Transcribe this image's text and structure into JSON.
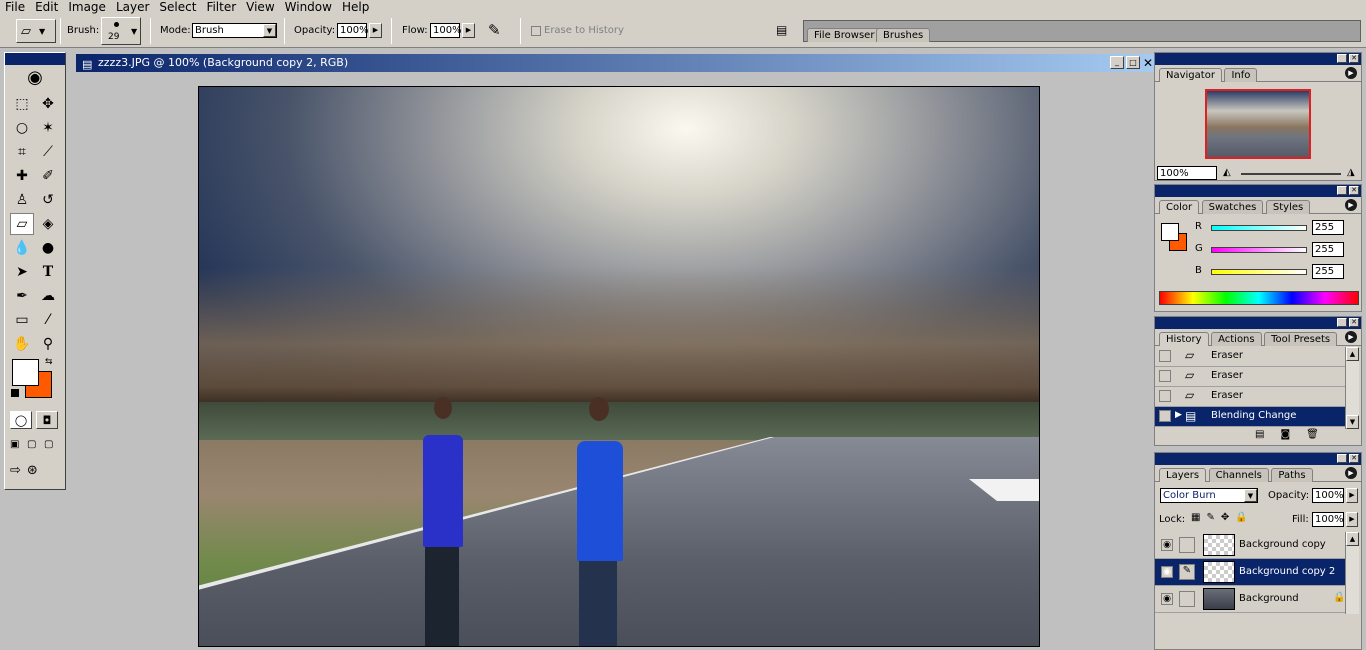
{
  "menu": [
    "File",
    "Edit",
    "Image",
    "Layer",
    "Select",
    "Filter",
    "View",
    "Window",
    "Help"
  ],
  "options": {
    "brush_label": "Brush:",
    "brush_size": "29",
    "mode_label": "Mode:",
    "mode_value": "Brush",
    "opacity_label": "Opacity:",
    "opacity_value": "100%",
    "flow_label": "Flow:",
    "flow_value": "100%",
    "erase_history": "Erase to History",
    "tab_file_browser": "File Browser",
    "tab_brushes": "Brushes"
  },
  "document": {
    "title": "zzzz3.JPG @ 100% (Background copy 2, RGB)"
  },
  "navigator": {
    "tabs": [
      "Navigator",
      "Info"
    ],
    "zoom": "100%"
  },
  "color": {
    "tabs": [
      "Color",
      "Swatches",
      "Styles"
    ],
    "channels": [
      {
        "label": "R",
        "value": "255"
      },
      {
        "label": "G",
        "value": "255"
      },
      {
        "label": "B",
        "value": "255"
      }
    ],
    "foreground": "#ffffff",
    "background": "#ff5a00"
  },
  "history": {
    "tabs": [
      "History",
      "Actions",
      "Tool Presets"
    ],
    "items": [
      "Eraser",
      "Eraser",
      "Eraser",
      "Blending Change"
    ]
  },
  "layers": {
    "tabs": [
      "Layers",
      "Channels",
      "Paths"
    ],
    "blend_mode": "Color Burn",
    "opacity_label": "Opacity:",
    "opacity": "100%",
    "lock_label": "Lock:",
    "fill_label": "Fill:",
    "fill": "100%",
    "items": [
      "Background copy",
      "Background copy 2",
      "Background"
    ]
  }
}
